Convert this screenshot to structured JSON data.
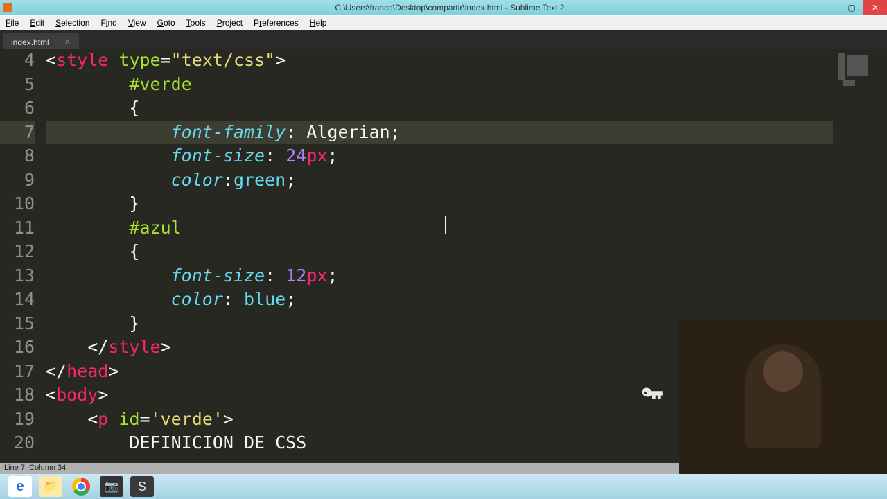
{
  "titlebar": {
    "title": "C:\\Users\\franco\\Desktop\\compartir\\index.html - Sublime Text 2"
  },
  "menus": [
    "File",
    "Edit",
    "Selection",
    "Find",
    "View",
    "Goto",
    "Tools",
    "Project",
    "Preferences",
    "Help"
  ],
  "tab": {
    "name": "index.html"
  },
  "gutter": {
    "start": 4,
    "end": 20,
    "active": 7
  },
  "code": {
    "4": [
      [
        "<",
        "white"
      ],
      [
        "style",
        "tag"
      ],
      [
        " ",
        "white"
      ],
      [
        "type",
        "attr"
      ],
      [
        "=",
        "white"
      ],
      [
        "\"text/css\"",
        "str"
      ],
      [
        ">",
        "white"
      ]
    ],
    "5": [
      [
        "        ",
        "white"
      ],
      [
        "#verde",
        "sel"
      ]
    ],
    "6": [
      [
        "        {",
        "white"
      ]
    ],
    "7": [
      [
        "            ",
        "white"
      ],
      [
        "font-family",
        "prop"
      ],
      [
        ": Algerian;",
        "white"
      ]
    ],
    "8": [
      [
        "            ",
        "white"
      ],
      [
        "font-size",
        "prop"
      ],
      [
        ": ",
        "white"
      ],
      [
        "24",
        "num"
      ],
      [
        "px",
        "unit"
      ],
      [
        ";",
        "white"
      ]
    ],
    "9": [
      [
        "            ",
        "white"
      ],
      [
        "color",
        "prop"
      ],
      [
        ":",
        "white"
      ],
      [
        "green",
        "val"
      ],
      [
        ";",
        "white"
      ]
    ],
    "10": [
      [
        "        }",
        "white"
      ]
    ],
    "11": [
      [
        "        ",
        "white"
      ],
      [
        "#azul",
        "sel"
      ]
    ],
    "12": [
      [
        "        {",
        "white"
      ]
    ],
    "13": [
      [
        "            ",
        "white"
      ],
      [
        "font-size",
        "prop"
      ],
      [
        ": ",
        "white"
      ],
      [
        "12",
        "num"
      ],
      [
        "px",
        "unit"
      ],
      [
        ";",
        "white"
      ]
    ],
    "14": [
      [
        "            ",
        "white"
      ],
      [
        "color",
        "prop"
      ],
      [
        ": ",
        "white"
      ],
      [
        "blue",
        "val"
      ],
      [
        ";",
        "white"
      ]
    ],
    "15": [
      [
        "        }",
        "white"
      ]
    ],
    "16": [
      [
        "    </",
        "white"
      ],
      [
        "style",
        "tag"
      ],
      [
        ">",
        "white"
      ]
    ],
    "17": [
      [
        "</",
        "white"
      ],
      [
        "head",
        "tag"
      ],
      [
        ">",
        "white"
      ]
    ],
    "18": [
      [
        "<",
        "white"
      ],
      [
        "body",
        "tag"
      ],
      [
        ">",
        "white"
      ]
    ],
    "19": [
      [
        "    <",
        "white"
      ],
      [
        "p",
        "tag"
      ],
      [
        " ",
        "white"
      ],
      [
        "id",
        "attr"
      ],
      [
        "=",
        "white"
      ],
      [
        "'verde'",
        "str"
      ],
      [
        ">",
        "white"
      ]
    ],
    "20": [
      [
        "        DEFINICION DE CSS",
        "white"
      ]
    ]
  },
  "statusbar": {
    "text": "Line 7, Column 34"
  },
  "taskbar_icons": [
    "ie",
    "folder",
    "chrome",
    "camera",
    "sublime"
  ]
}
